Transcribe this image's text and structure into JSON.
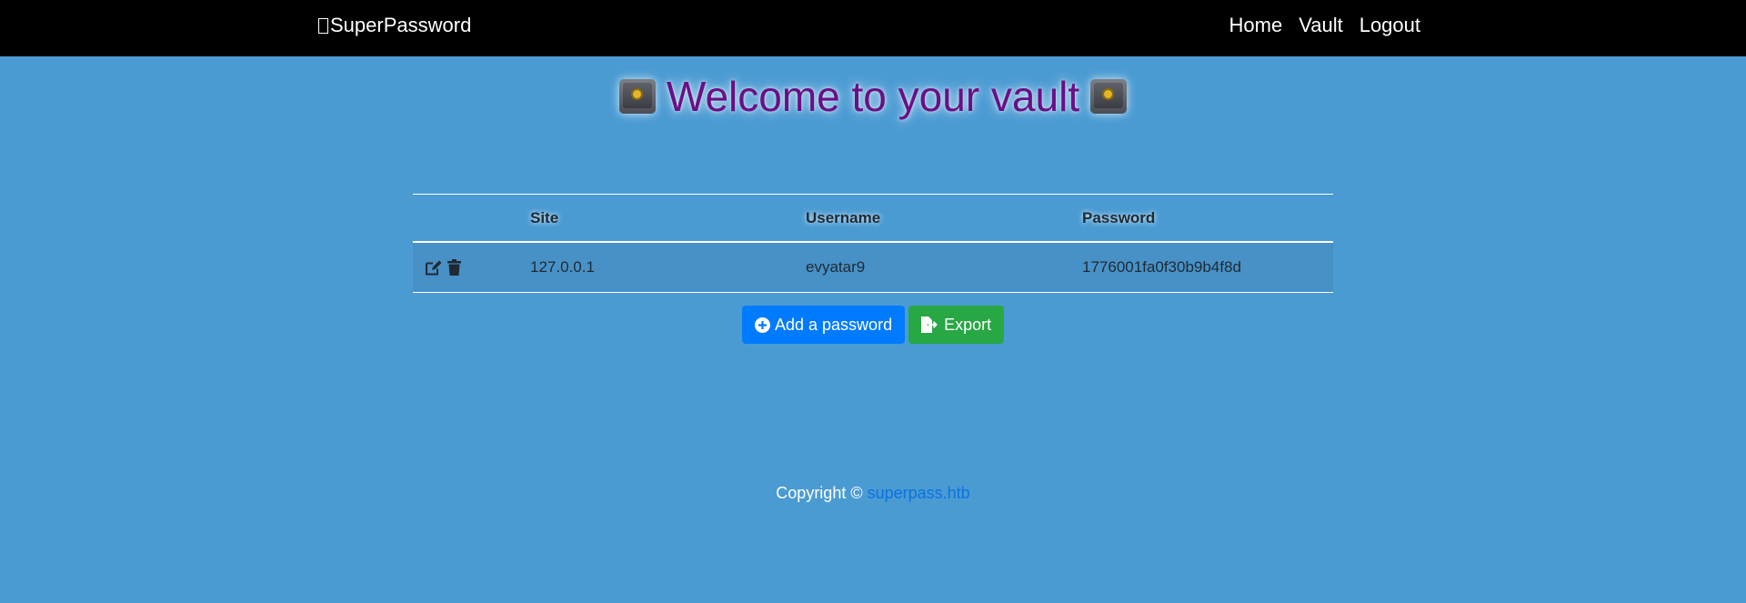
{
  "navbar": {
    "brand": "SuperPassword",
    "links": [
      "Home",
      "Vault",
      "Logout"
    ]
  },
  "heading": {
    "text": "Welcome to your vault",
    "icon": "safe-icon"
  },
  "table": {
    "columns": [
      "",
      "Site",
      "Username",
      "Password"
    ],
    "rows": [
      {
        "actions": [
          "edit-icon",
          "trash-icon"
        ],
        "site": "127.0.0.1",
        "username": "evyatar9",
        "password": "1776001fa0f30b9b4f8d"
      }
    ]
  },
  "buttons": {
    "add": "Add a password",
    "export": "Export"
  },
  "footer": {
    "prefix": "Copyright © ",
    "link": "superpass.htb"
  },
  "colors": {
    "background": "#4b9bd3",
    "navbar": "#000000",
    "heading": "#6a0f86",
    "primary": "#007bff",
    "success": "#28a745",
    "link": "#0a73e0"
  }
}
